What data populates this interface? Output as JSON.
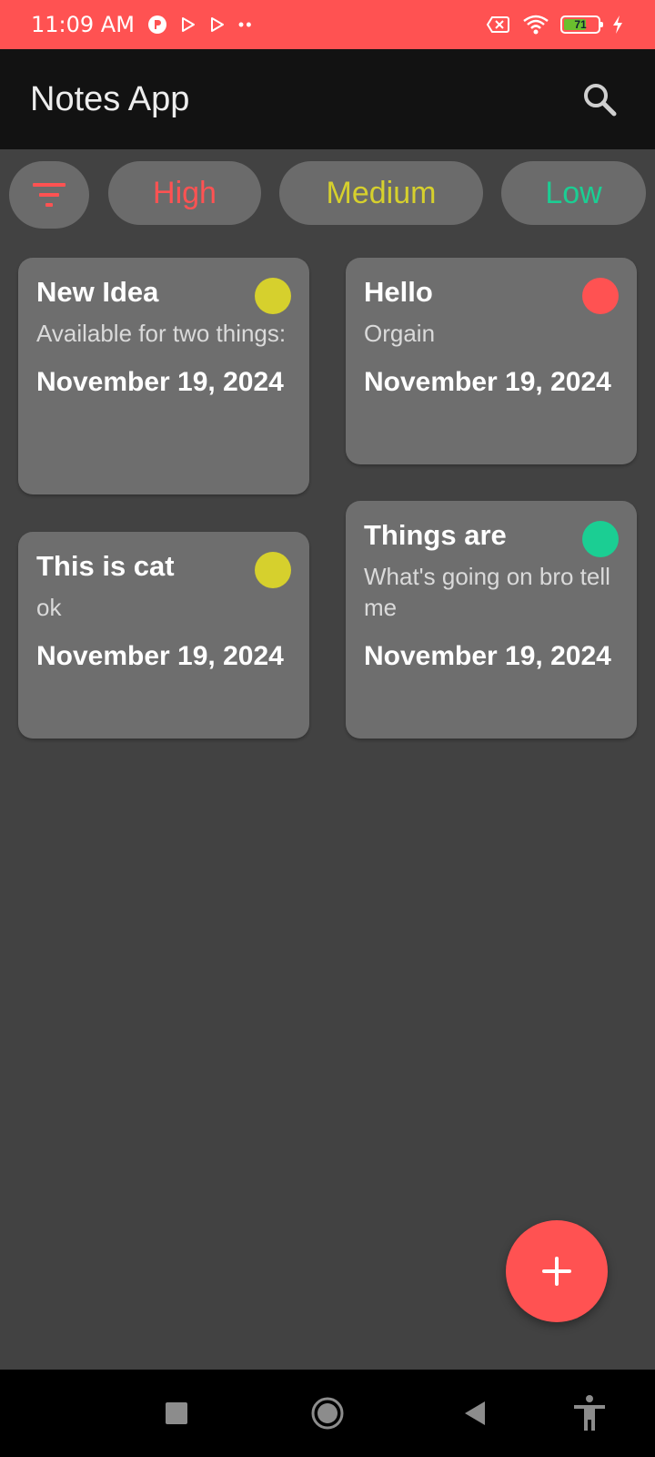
{
  "status_bar": {
    "time": "11:09 AM",
    "more_indicator": "••",
    "battery_level": 71,
    "battery_text": "71",
    "icons": [
      "notification-app-icon",
      "play-store-icon",
      "play-store-icon",
      "no-sim-icon",
      "wifi-icon",
      "battery-icon",
      "charging-icon"
    ]
  },
  "app_bar": {
    "title": "Notes App",
    "search_icon": "search-icon"
  },
  "filters": {
    "filter_icon": "filter-icon",
    "chips": [
      {
        "label": "High",
        "color": "#FF5252"
      },
      {
        "label": "Medium",
        "color": "#D6D02D"
      },
      {
        "label": "Low",
        "color": "#1BCE93"
      }
    ]
  },
  "notes": [
    {
      "title": "New Idea",
      "body": "Available for two things:",
      "date": "November 19, 2024",
      "priority_color": "#D6D02D"
    },
    {
      "title": "Hello",
      "body": "Orgain",
      "date": "November 19, 2024",
      "priority_color": "#FF5252"
    },
    {
      "title": "This is cat",
      "body": "ok",
      "date": "November 19, 2024",
      "priority_color": "#D6D02D"
    },
    {
      "title": "Things are",
      "body": "What's going on bro tell me",
      "date": "November 19, 2024",
      "priority_color": "#1BCE93"
    }
  ],
  "fab": {
    "icon": "add-icon"
  },
  "colors": {
    "accent": "#FF5252",
    "background": "#424242",
    "app_bar": "#121212",
    "card": "#6E6E6E"
  },
  "nav_bar": {
    "icons": [
      "recents-icon",
      "home-icon",
      "back-icon",
      "accessibility-icon"
    ]
  }
}
